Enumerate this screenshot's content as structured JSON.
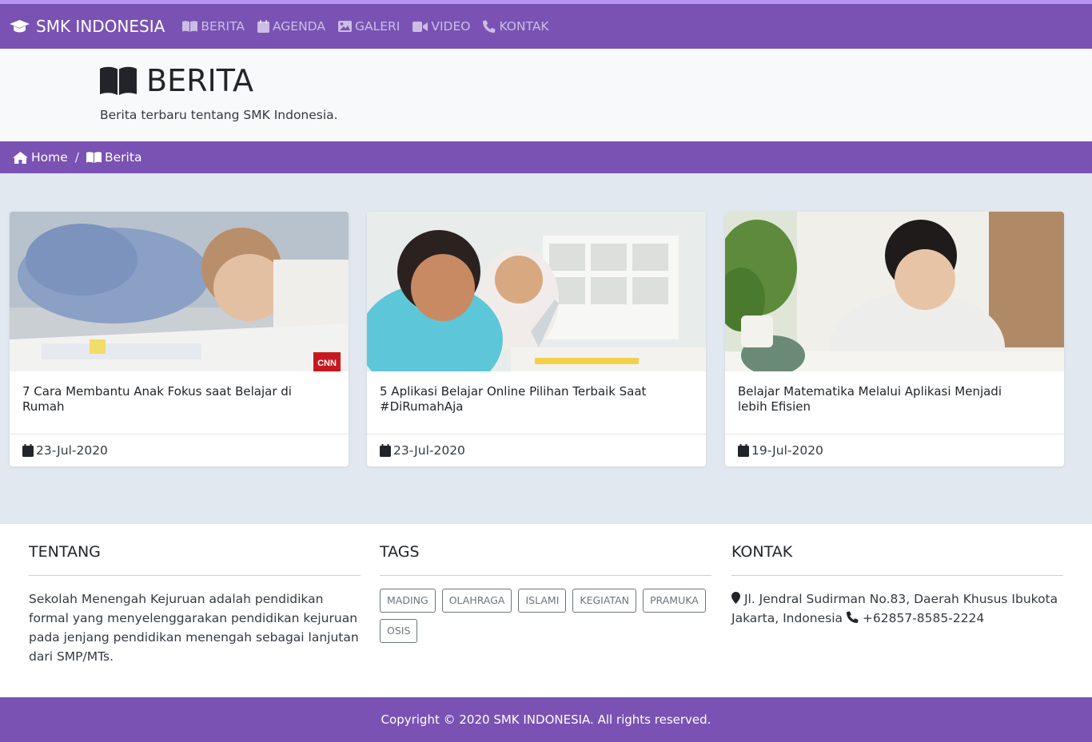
{
  "nav": {
    "brand": "SMK INDONESIA",
    "items": [
      {
        "label": "BERITA",
        "icon": "book-open-icon"
      },
      {
        "label": "AGENDA",
        "icon": "calendar-icon"
      },
      {
        "label": "GALERI",
        "icon": "image-icon"
      },
      {
        "label": "VIDEO",
        "icon": "video-camera-icon"
      },
      {
        "label": "KONTAK",
        "icon": "phone-icon"
      }
    ]
  },
  "header": {
    "title": "BERITA",
    "subtitle": "Berita terbaru tentang SMK Indonesia."
  },
  "breadcrumb": {
    "home": "Home",
    "separator": "/",
    "current": "Berita"
  },
  "cards": [
    {
      "title": "7 Cara Membantu Anak Fokus saat Belajar di Rumah",
      "date": "23-Jul-2020",
      "badge": "CNN"
    },
    {
      "title": "5 Aplikasi Belajar Online Pilihan Terbaik Saat #DiRumahAja",
      "date": "23-Jul-2020"
    },
    {
      "title": "Belajar Matematika Melalui Aplikasi Menjadi lebih Efisien",
      "date": "19-Jul-2020"
    }
  ],
  "footer": {
    "about": {
      "heading": "TENTANG",
      "text": "Sekolah Menengah Kejuruan adalah pendidikan formal yang menyelenggarakan pendidikan kejuruan pada jenjang pendidikan menengah sebagai lanjutan dari SMP/MTs."
    },
    "tags": {
      "heading": "TAGS",
      "items": [
        "MADING",
        "OLAHRAGA",
        "ISLAMI",
        "KEGIATAN",
        "PRAMUKA",
        "OSIS"
      ]
    },
    "contact": {
      "heading": "KONTAK",
      "address": "Jl. Jendral Sudirman No.83, Daerah Khusus Ibukota Jakarta, Indonesia",
      "phone": "+62857-8585-2224"
    },
    "copyright": "Copyright © 2020 SMK INDONESIA. All rights reserved."
  },
  "colors": {
    "primary": "#7952b3",
    "top_accent": "#b794f4",
    "page_bg": "#e2e8f0",
    "header_bg": "#f8f9fa"
  }
}
